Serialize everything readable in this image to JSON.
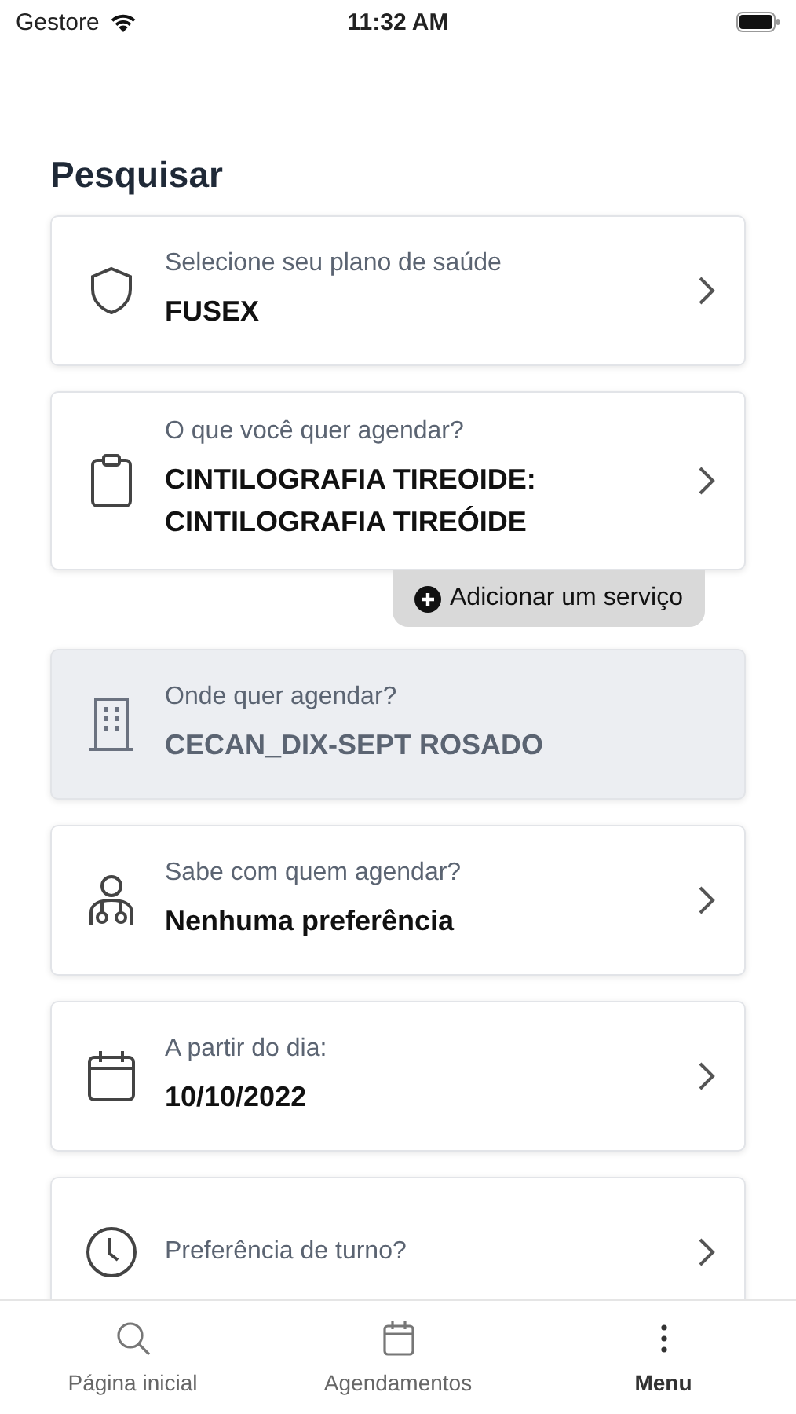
{
  "status_bar": {
    "carrier": "Gestore",
    "time": "11:32 AM"
  },
  "title": "Pesquisar",
  "fields": [
    {
      "label": "Selecione seu plano de saúde",
      "value": "FUSEX",
      "disabled": false
    },
    {
      "label": "O que você quer agendar?",
      "value": "CINTILOGRAFIA TIREOIDE: CINTILOGRAFIA TIREÓIDE",
      "disabled": false
    },
    {
      "label": "Onde quer agendar?",
      "value": "CECAN_DIX-SEPT ROSADO",
      "disabled": true
    },
    {
      "label": "Sabe com quem agendar?",
      "value": "Nenhuma preferência",
      "disabled": false
    },
    {
      "label": "A partir do dia:",
      "value": "10/10/2022",
      "disabled": false
    },
    {
      "label": "Preferência de turno?",
      "disabled": false
    }
  ],
  "add_service_button": "Adicionar um serviço",
  "tab_bar": [
    {
      "label": "Página inicial",
      "selected": false
    },
    {
      "label": "Agendamentos",
      "selected": false
    },
    {
      "label": "Menu",
      "selected": true
    }
  ]
}
